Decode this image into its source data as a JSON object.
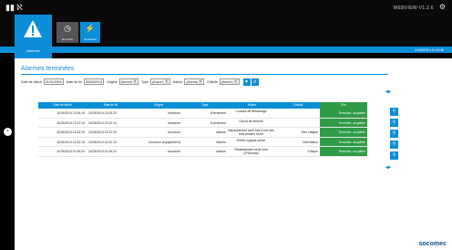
{
  "header": {
    "brand": "WEBVIEW-V1.2.6",
    "datetime": "31/08/2014 11:14:46"
  },
  "nav": {
    "alarm_tile_label": "Alarmes",
    "tabs": [
      {
        "label": "En cours"
      },
      {
        "label": "Terminées"
      }
    ]
  },
  "panel": {
    "title": "Alarmes terminées"
  },
  "filters": {
    "start_label": "Date de début",
    "start_value": "01/01/2000",
    "end_label": "Date de fin",
    "end_value": "09/04/2014",
    "origin_label": "Origine",
    "origin_value": "(Aucun)",
    "type_label": "Type",
    "type_value": "(Aucun)",
    "nature_label": "Nature",
    "nature_value": "(Aucun)",
    "criticity_label": "Criticité",
    "criticity_value": "(Aucun)"
  },
  "table": {
    "headers": [
      "Date de début",
      "Date de fin",
      "Origine",
      "Type",
      "Nature",
      "Criticité",
      "État"
    ],
    "rows": [
      [
        "11/03/2014 13:26:10",
        "11/03/2014 13:26:20",
        "Inconnue",
        "Evènement",
        "Courant de démarrage",
        "",
        "Terminée, acquittée"
      ],
      [
        "11/03/2014 13:22:14",
        "11/03/2014 13:22:14",
        "Inconnue",
        "Evènement",
        "Circuit de terminé",
        "",
        "Terminée, acquittée"
      ],
      [
        "11/03/2014 13:22:10",
        "11/03/2014 13:22:10",
        "Inconnue",
        "Alarme",
        "Dépassement seuil bas d'une des trois phases d'une",
        "Non critique",
        "Terminée, acquittée"
      ],
      [
        "11/03/2014 13:22:10",
        "11/03/2014 13:22:10",
        "Inconnue (équipement)",
        "Alarme",
        "Entrée logique active",
        "Information",
        "Terminée, acquittée"
      ],
      [
        "11/03/2014 10:16:24",
        "11/03/2014 10:16:24",
        "Inconnue",
        "Alarme",
        "Dépassement seuil haut (IPSumtot)",
        "Critique",
        "Terminée, acquittée"
      ]
    ]
  },
  "footer": {
    "logo": "socomec"
  },
  "colors": {
    "accent": "#0a8ed8",
    "status_green": "#2f9b48"
  }
}
